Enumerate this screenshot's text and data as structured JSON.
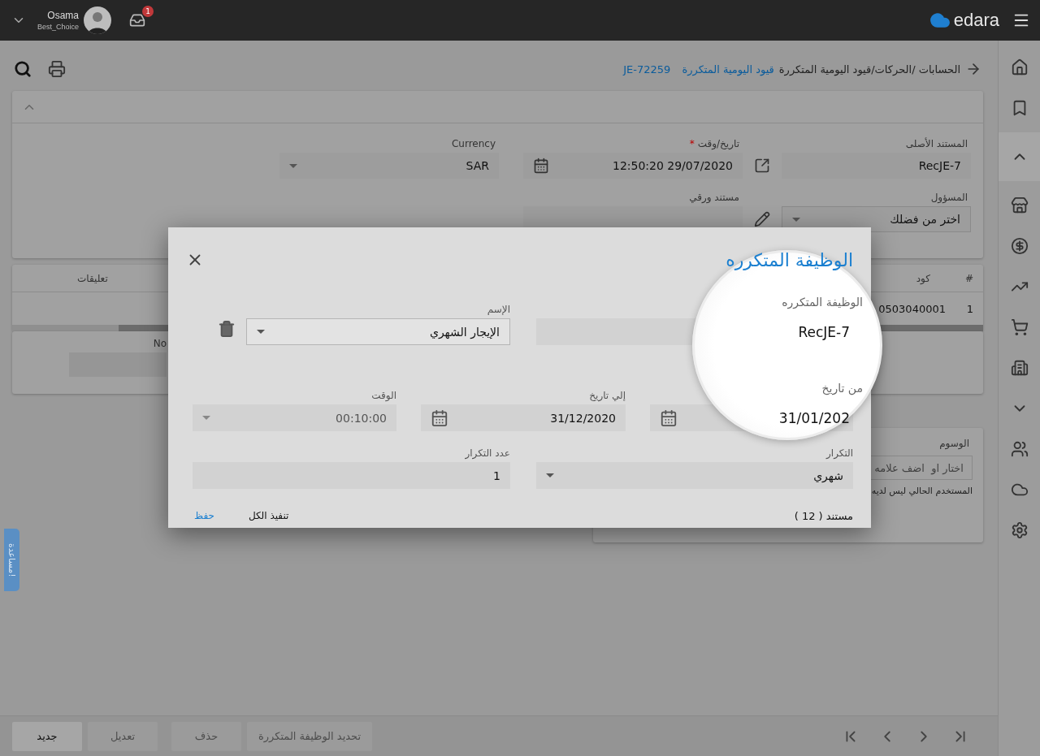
{
  "topbar": {
    "user_name": "Osama",
    "company": "Best_Choice",
    "notification_count": "1",
    "brand": "edara"
  },
  "sidebar": {
    "items": [
      {
        "kind": "home",
        "selected": false
      },
      {
        "kind": "bookmark",
        "selected": false
      },
      {
        "kind": "collapse",
        "selected": true
      },
      {
        "kind": "store",
        "selected": false
      },
      {
        "kind": "dollar",
        "selected": false
      },
      {
        "kind": "trend",
        "selected": false
      },
      {
        "kind": "cart",
        "selected": false
      },
      {
        "kind": "building",
        "selected": false
      },
      {
        "kind": "expand",
        "selected": false
      },
      {
        "kind": "people",
        "selected": false
      },
      {
        "kind": "cloud",
        "selected": false
      },
      {
        "kind": "settings",
        "selected": false
      }
    ]
  },
  "breadcrumb": {
    "path": "الحسابات /الحركات/قيود اليومية المتكررة",
    "link": "قيود اليومية المتكررة",
    "record": "JE-72259"
  },
  "header_form": {
    "row_1": [
      {
        "kind": "text",
        "label": "المستند الأصلى",
        "value": "RecJE-7"
      },
      {
        "kind": "date",
        "label": "تاريخ/وقت",
        "value": "12:50:20 29/07/2020",
        "required_mark": "*"
      },
      {
        "kind": "select",
        "label": "Currency",
        "value": "SAR"
      }
    ],
    "row_2": [
      {
        "kind": "select",
        "label": "المسؤول",
        "placeholder": "اختر من فضلك"
      },
      {
        "kind": "file",
        "label": "مستند ورقي"
      }
    ]
  },
  "lines_table": {
    "columns": [
      "#",
      "كود",
      "تعليقات"
    ],
    "rows": [
      [
        "1",
        "0503040001"
      ]
    ]
  },
  "notes": {
    "label": "No"
  },
  "tags": {
    "label": "الوسوم",
    "placeholder": "اختار او  اضف علامه",
    "note": "المستخدم الحالي ليس لديه"
  },
  "help_tab": "مساعدة!",
  "actions": [
    {
      "label": "تحديد الوظيفة المتكررة",
      "disabled": true
    },
    {
      "label": "حذف",
      "disabled": true
    },
    {
      "label": "تعديل",
      "disabled": true
    },
    {
      "label": "جديد",
      "disabled": false
    }
  ],
  "dialog": {
    "title": "الوظيفة المتكرره",
    "rows": [
      [
        {
          "kind": "text",
          "label": "الوظيفة المتكرره",
          "value": "RecJE-7",
          "zoomed": true,
          "disabled": false
        },
        {
          "kind": "removable_select",
          "label": "الإسم",
          "value": "الإيجار الشهري",
          "zoomed": false,
          "disabled": false
        }
      ],
      [
        {
          "kind": "date",
          "label": "من تاريخ",
          "value": "31/01/202",
          "zoomed": true,
          "disabled": false
        },
        {
          "kind": "date",
          "label": "إلي تاريخ",
          "value": "31/12/2020",
          "zoomed": false,
          "disabled": false
        },
        {
          "kind": "select",
          "label": "الوقت",
          "value": "00:10:00",
          "zoomed": false,
          "disabled": true
        }
      ],
      [
        {
          "kind": "select",
          "label": "التكرار",
          "value": "شهري",
          "zoomed": false,
          "disabled": false
        },
        {
          "kind": "text",
          "label": "عدد التكرار",
          "value": "1",
          "zoomed": false,
          "disabled": false
        }
      ]
    ],
    "document_count": "مستند ( 12 )",
    "buttons": [
      {
        "label": "تنفيذ الكل",
        "kind": "default"
      },
      {
        "label": "حفظ",
        "kind": "primary"
      }
    ]
  }
}
